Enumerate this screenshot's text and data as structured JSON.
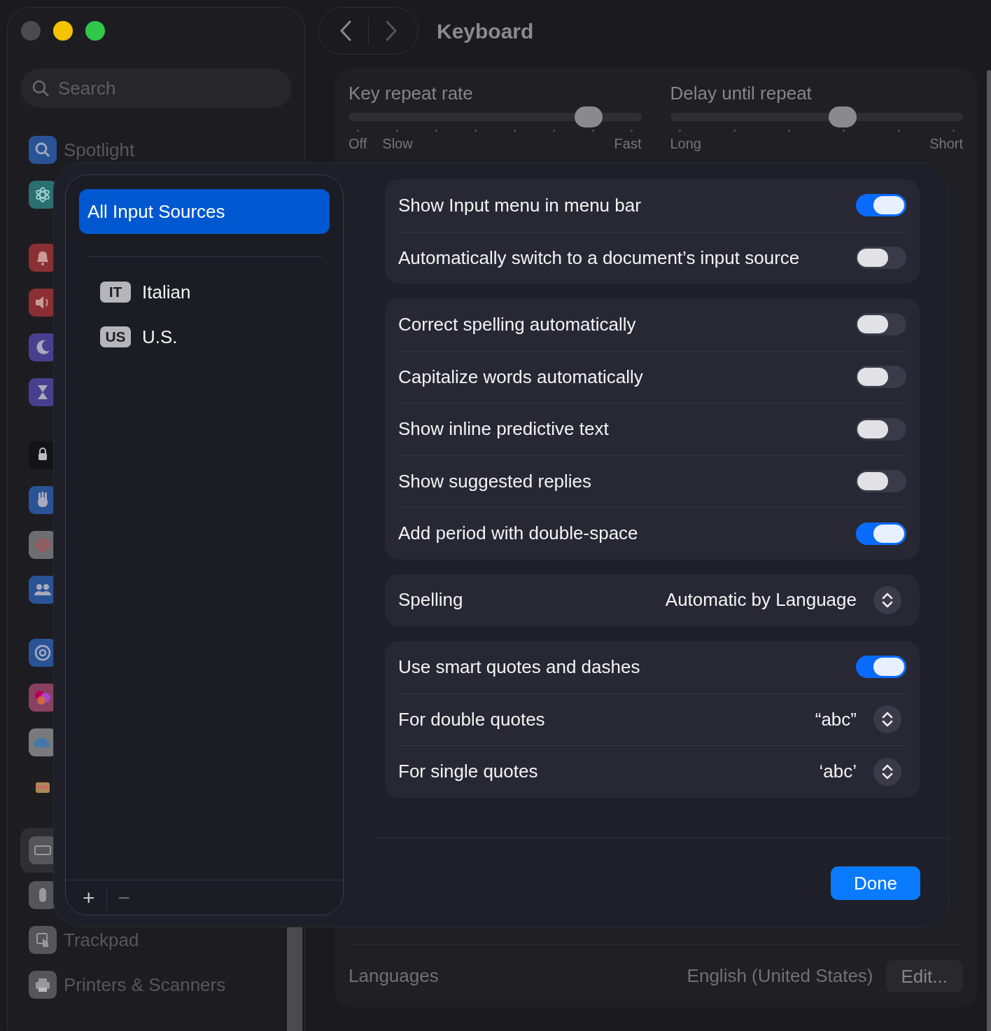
{
  "window": {
    "title": "Keyboard",
    "traffic_lights": [
      {
        "color": "#4a4a50"
      },
      {
        "color": "#f5c400"
      },
      {
        "color": "#2fc84a"
      }
    ]
  },
  "sidebar": {
    "search": {
      "placeholder": "Search"
    },
    "groups": [
      {
        "items": [
          {
            "label": "Spotlight",
            "color": "#2a5396",
            "selected": false
          },
          {
            "color": "#2c6f70",
            "selected": false
          }
        ]
      },
      {
        "items": [
          {
            "color": "#8a2f33",
            "selected": false
          },
          {
            "color": "#8a2f33",
            "selected": false
          },
          {
            "color": "#4a3f8f",
            "selected": false
          },
          {
            "color": "#4a3f8f",
            "selected": false
          }
        ]
      },
      {
        "items": [
          {
            "color": "#141416",
            "selected": false
          },
          {
            "color": "#2a5396",
            "selected": false
          },
          {
            "color": "#6e6e72",
            "selected": false
          },
          {
            "color": "#2a5396",
            "selected": false
          }
        ]
      },
      {
        "items": [
          {
            "color": "#2a5396",
            "selected": false
          },
          {
            "color": "#8a4060",
            "selected": false
          },
          {
            "color": "#7a7a7e",
            "selected": false
          },
          {
            "color": "#1e1e20",
            "selected": false
          }
        ]
      },
      {
        "items": [
          {
            "color": "#55555a",
            "selected": true
          },
          {
            "color": "#55555a",
            "selected": false
          },
          {
            "label": "Trackpad",
            "color": "#55555a",
            "selected": false
          },
          {
            "label": "Printers & Scanners",
            "color": "#55555a",
            "selected": false
          }
        ]
      }
    ]
  },
  "sliders": [
    {
      "label": "Key repeat rate",
      "level": 0.82,
      "min_labels": [
        "Off",
        "Slow"
      ],
      "max_label": "Fast"
    },
    {
      "label": "Delay until repeat",
      "level": 0.59,
      "min_labels": [
        "Long"
      ],
      "max_label": "Short"
    }
  ],
  "languages": {
    "label": "Languages",
    "value": "English (United States)",
    "button": "Edit..."
  },
  "sheet": {
    "sources": [
      {
        "label": "All Input Sources",
        "selected": true
      },
      {
        "badge": "IT",
        "label": "Italian",
        "selected": false
      },
      {
        "badge": "US",
        "label": "U.S.",
        "selected": false
      }
    ],
    "list_buttons": [
      "+",
      "−"
    ],
    "groups": [
      {
        "rows": [
          {
            "kind": "toggle",
            "label": "Show Input menu in menu bar",
            "on": true
          },
          {
            "kind": "toggle",
            "label": "Automatically switch to a document’s input source",
            "on": false
          }
        ]
      },
      {
        "rows": [
          {
            "kind": "toggle",
            "label": "Correct spelling automatically",
            "on": false
          },
          {
            "kind": "toggle",
            "label": "Capitalize words automatically",
            "on": false
          },
          {
            "kind": "toggle",
            "label": "Show inline predictive text",
            "on": false
          },
          {
            "kind": "toggle",
            "label": "Show suggested replies",
            "on": false
          },
          {
            "kind": "toggle",
            "label": "Add period with double-space",
            "on": true
          }
        ]
      },
      {
        "rows": [
          {
            "kind": "popup",
            "label": "Spelling",
            "value": "Automatic by Language"
          }
        ]
      },
      {
        "rows": [
          {
            "kind": "toggle",
            "label": "Use smart quotes and dashes",
            "on": true
          },
          {
            "kind": "popup",
            "label": "For double quotes",
            "value": "“abc”"
          },
          {
            "kind": "popup",
            "label": "For single quotes",
            "value": "‘abc’"
          }
        ]
      }
    ],
    "done_button": "Done"
  }
}
